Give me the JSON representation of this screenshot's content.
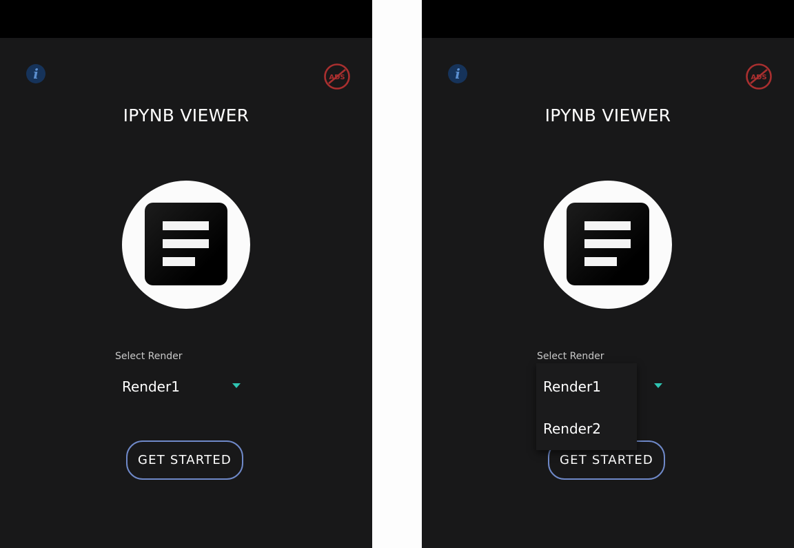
{
  "colors": {
    "background": "#181819",
    "status_bar": "#000000",
    "accent_arrow": "#2fc4b2",
    "button_border": "#6f89c9",
    "info_icon": "#16335a",
    "ads_icon": "#a92f2f"
  },
  "screens": [
    {
      "title": "IPYNB VIEWER",
      "info_icon": "info-icon",
      "ads_icon": "no-ads-icon",
      "ads_text": "ADS",
      "select_label": "Select Render",
      "selected_value": "Render1",
      "button_label": "GET STARTED",
      "dropdown_open": false
    },
    {
      "title": "IPYNB VIEWER",
      "info_icon": "info-icon",
      "ads_icon": "no-ads-icon",
      "ads_text": "ADS",
      "select_label": "Select Render",
      "selected_value": "Render1",
      "button_label": "GET STARTED",
      "dropdown_open": true,
      "dropdown_options": [
        "Render1",
        "Render2"
      ]
    }
  ]
}
